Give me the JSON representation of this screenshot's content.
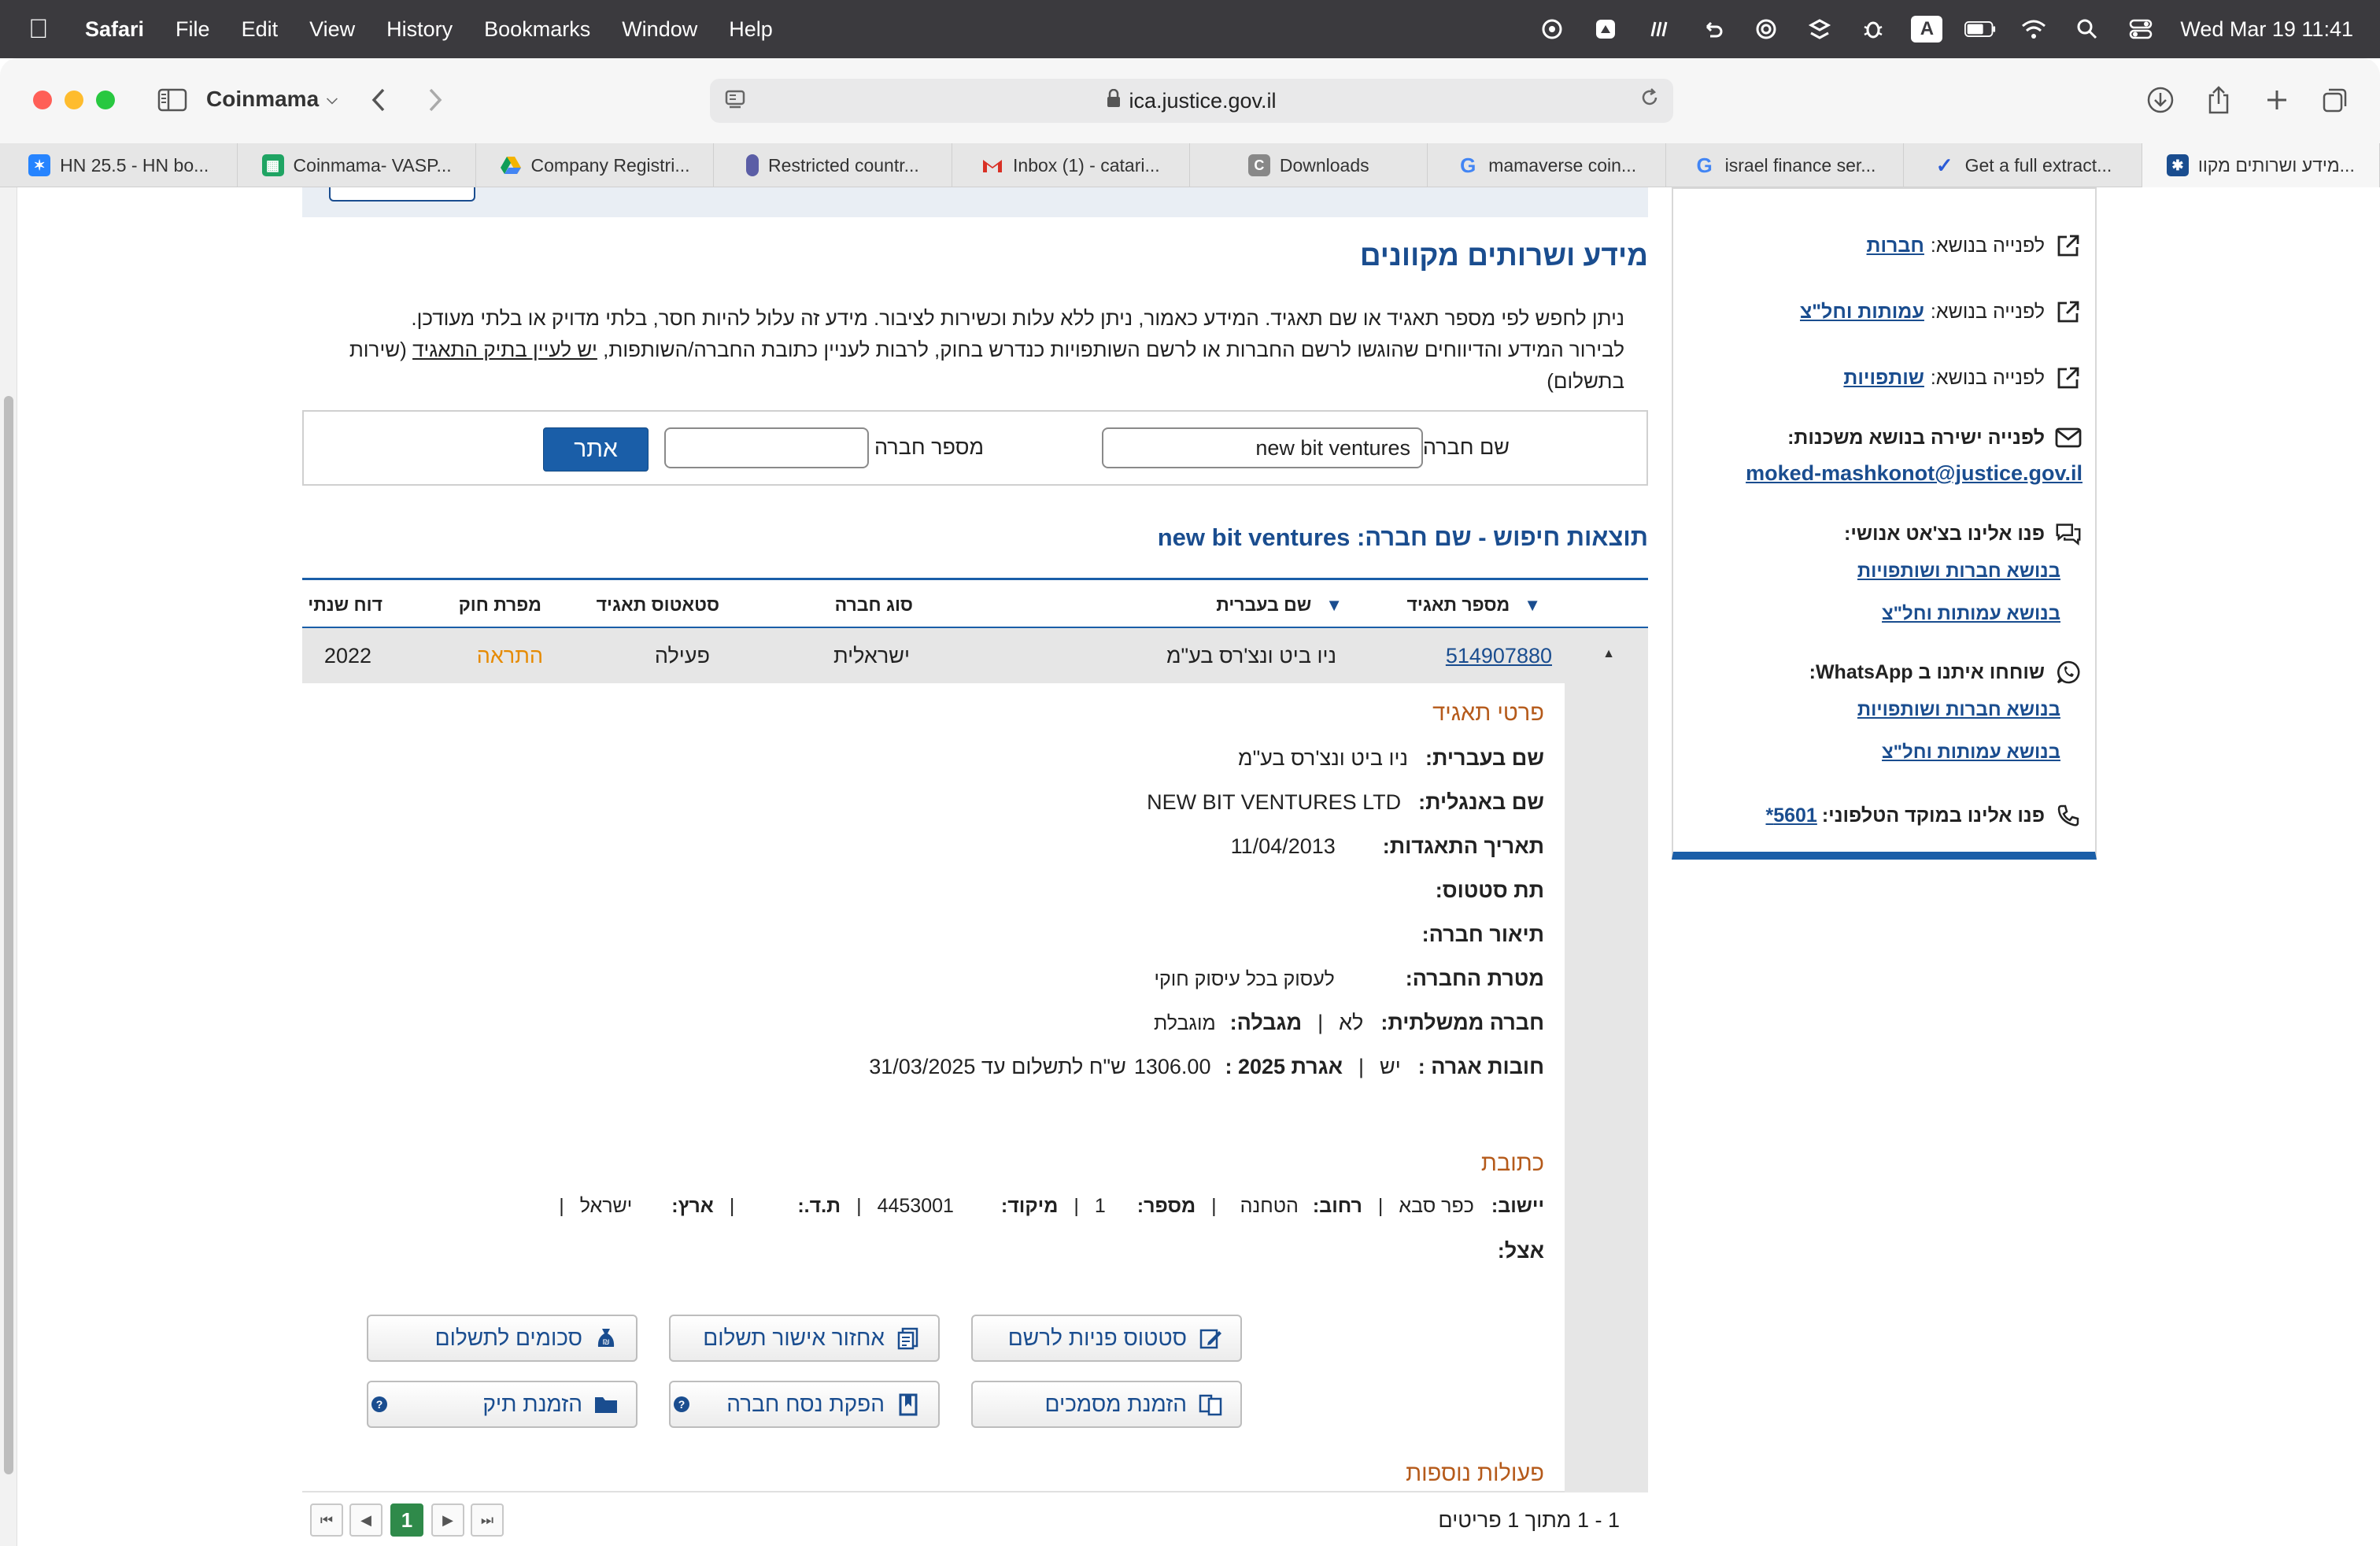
{
  "menubar": {
    "app": "Safari",
    "items": [
      "File",
      "Edit",
      "View",
      "History",
      "Bookmarks",
      "Window",
      "Help"
    ],
    "clock": "Wed Mar 19  11:41",
    "input_source": "A"
  },
  "toolbar": {
    "tab_group": "Coinmama",
    "address": "ica.justice.gov.il"
  },
  "tabs": [
    {
      "label": "HN 25.5 - HN bo...",
      "icon": "jira-icon",
      "color": "#2684ff"
    },
    {
      "label": "Coinmama- VASP...",
      "icon": "sheets-icon",
      "color": "#1fa463"
    },
    {
      "label": "Company Registri...",
      "icon": "drive-icon",
      "color": "#f4b400"
    },
    {
      "label": "Restricted countr...",
      "icon": "doc-icon",
      "color": "#5b5ea6"
    },
    {
      "label": "Inbox (1) - catari...",
      "icon": "gmail-icon",
      "color": "#d93025"
    },
    {
      "label": "Downloads",
      "icon": "c-icon",
      "color": "#777777"
    },
    {
      "label": "mamaverse coin...",
      "icon": "google-icon",
      "color": "#4285f4"
    },
    {
      "label": "israel finance ser...",
      "icon": "google-icon",
      "color": "#4285f4"
    },
    {
      "label": "Get a full extract...",
      "icon": "check-icon",
      "color": "#2a5bd7"
    },
    {
      "label": "מידע ושרותים מקוו...",
      "icon": "gov-icon",
      "color": "#1a4d8f"
    }
  ],
  "page": {
    "title": "מידע ושרותים מקוונים",
    "desc_line1": "ניתן לחפש לפי מספר תאגיד או שם תאגיד. המידע כאמור, ניתן ללא עלות וכשירות לציבור. מידע זה עלול להיות חסר, בלתי מדויק או בלתי מעודכן.",
    "desc_line2_a": "לבירור המידע והדיווחים שהוגשו לרשם החברות או לרשם השותפויות כנדרש בחוק, לרבות לעניין כתובת החברה/השותפות, ",
    "desc_link": "יש לעיין בתיק התאגיד",
    "desc_line2_b": " (שירות בתשלום)",
    "search": {
      "name_label": "שם חברה",
      "name_value": "new bit ventures",
      "number_label": "מספר חברה",
      "number_value": "",
      "button": "אתר"
    },
    "results_title": "תוצאות חיפוש - שם חברה: new bit ventures",
    "table": {
      "headers": {
        "number": "מספר תאגיד",
        "name_he": "שם בעברית",
        "type": "סוג חברה",
        "status": "סטאטוס תאגיד",
        "violator": "מפרת חוק",
        "annual": "דוח שנתי"
      },
      "row": {
        "number": "514907880",
        "name_he": "ניו ביט ונצ'רס בע\"מ",
        "type": "ישראלית",
        "status": "פעילה",
        "violator": "התראה",
        "annual": "2022"
      }
    },
    "details": {
      "section": "פרטי תאגיד",
      "name_he_k": "שם בעברית:",
      "name_he_v": "ניו ביט ונצ'רס בע\"מ",
      "name_en_k": "שם באנגלית:",
      "name_en_v": "NEW BIT VENTURES LTD",
      "inc_date_k": "תאריך התאגדות:",
      "inc_date_v": "11/04/2013",
      "substatus_k": "תת סטטוס:",
      "desc_k": "תיאור חברה:",
      "purpose_k": "מטרת החברה:",
      "purpose_v": "לעסוק בכל עיסוק חוקי",
      "gov_k": "חברה ממשלתית:",
      "gov_v": "לא",
      "limited_k": "מגבלה:",
      "limited_v": "מוגבלת",
      "fees_k": "חובות אגרה :",
      "fees_v": "יש",
      "fee_year_k": "אגרת 2025 :",
      "fee_amount": "1306.00",
      "fee_text": "ש\"ח לתשלום עד 31/03/2025"
    },
    "address": {
      "section": "כתובת",
      "city_k": "יישוב:",
      "city_v": "כפר סבא",
      "street_k": "רחוב:",
      "street_v": "הטחנה",
      "num_k": "מספר:",
      "num_v": "1",
      "zip_k": "מיקוד:",
      "zip_v": "4453001",
      "pobox_k": "ת.ד.:",
      "country_k": "ארץ:",
      "country_v": "ישראל",
      "care_k": "אצל:"
    },
    "actions": {
      "section": "פעולות נוספות",
      "filing_status": "סטטוס פניות לרשם",
      "payment_restore": "אחזור אישור תשלום",
      "amounts_due": "סכומים לתשלום",
      "order_docs": "הזמנת מסמכים",
      "company_extract": "הפקת נסח חברה",
      "order_file": "הזמנת תיק"
    },
    "pager": {
      "current": "1",
      "info": "1 - 1 מתוך 1 פריטים"
    }
  },
  "sidebar": {
    "companies_k": "לפנייה בנושא:",
    "companies_v": "חברות",
    "amutot_k": "לפנייה בנושא:",
    "amutot_v": "עמותות וחל\"צ",
    "partnerships_k": "לפנייה בנושא:",
    "partnerships_v": "שותפויות",
    "mortgage_k": "לפנייה ישירה בנושא משכנות:",
    "mortgage_email": "moked-mashkonot@justice.gov.il",
    "chat_k": "פנו אלינו בצ'אט אנושי:",
    "chat_link1": "בנושא חברות ושותפויות",
    "chat_link2": "בנושא עמותות וחל\"צ",
    "wa_k": "שוחחו איתנו ב WhatsApp:",
    "wa_link1": "בנושא חברות ושותפויות",
    "wa_link2": "בנושא עמותות וחל\"צ",
    "phone_k": "פנו אלינו במוקד הטלפוני:",
    "phone_v": "5601*"
  }
}
